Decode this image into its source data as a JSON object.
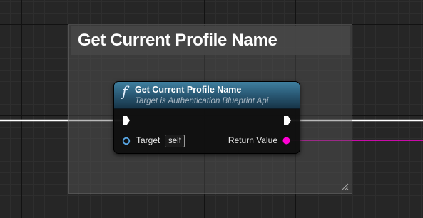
{
  "comment": {
    "title": "Get Current Profile Name"
  },
  "node": {
    "title": "Get Current Profile Name",
    "subtitle": "Target is Authentication Blueprint Api",
    "function_icon": "f",
    "pins": {
      "target_label": "Target",
      "target_default": "self",
      "return_label": "Return Value"
    }
  },
  "colors": {
    "node_header": "#2b5c78",
    "exec_wire": "#ffffff",
    "string_wire": "#ff00d4",
    "target_pin": "#58a6e4",
    "grid_background": "#262626"
  },
  "icons": {
    "function": "function-icon",
    "exec_in": "exec-pin-icon",
    "exec_out": "exec-pin-icon",
    "target": "object-pin-icon",
    "return": "string-pin-icon",
    "resize": "resize-grip-icon"
  }
}
